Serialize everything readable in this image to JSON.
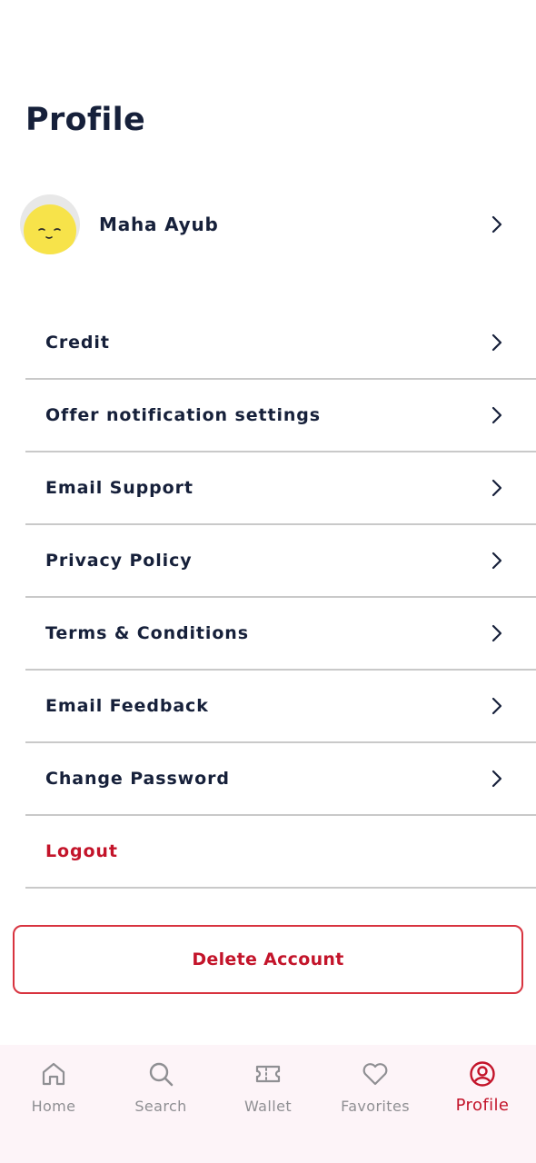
{
  "page": {
    "title": "Profile"
  },
  "profile": {
    "name": "Maha Ayub"
  },
  "menu": {
    "items": [
      {
        "label": "Credit"
      },
      {
        "label": "Offer notification settings"
      },
      {
        "label": "Email Support"
      },
      {
        "label": "Privacy Policy"
      },
      {
        "label": "Terms & Conditions"
      },
      {
        "label": "Email Feedback"
      },
      {
        "label": "Change Password"
      }
    ],
    "logout_label": "Logout"
  },
  "delete_account": {
    "label": "Delete Account"
  },
  "tabbar": {
    "active": "Profile",
    "tabs": [
      {
        "label": "Home",
        "icon": "home-icon"
      },
      {
        "label": "Search",
        "icon": "search-icon"
      },
      {
        "label": "Wallet",
        "icon": "ticket-icon"
      },
      {
        "label": "Favorites",
        "icon": "heart-icon"
      },
      {
        "label": "Profile",
        "icon": "user-circle-icon"
      }
    ]
  },
  "colors": {
    "text": "#16203a",
    "accent": "#c3142a",
    "divider": "#c9c9c9",
    "inactive_tab": "#8f8f93",
    "tabbar_bg": "#fdf4f8",
    "avatar_face": "#f7e34a"
  }
}
